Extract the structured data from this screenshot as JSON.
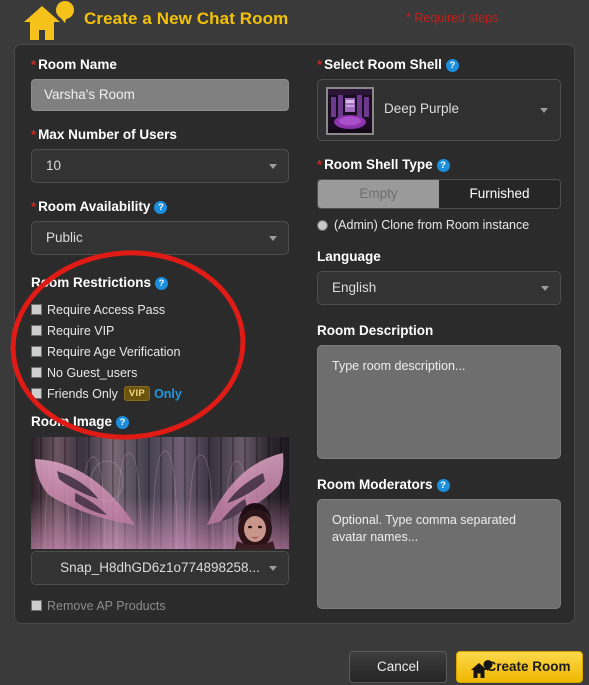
{
  "header": {
    "logo_icon": "house-chat-logo",
    "title": "Create a New Chat Room",
    "required_note": "* Required steps"
  },
  "left": {
    "room_name": {
      "label": "Room Name",
      "required": "*",
      "value": "Varsha's Room"
    },
    "max_users": {
      "label": "Max Number of Users",
      "required": "*",
      "value": "10"
    },
    "room_availability": {
      "label": "Room Availability",
      "required": "*",
      "help": "?",
      "value": "Public"
    },
    "room_restrictions": {
      "label": "Room Restrictions",
      "help": "?",
      "items": [
        {
          "label": "Require Access Pass",
          "checked": false
        },
        {
          "label": "Require VIP",
          "checked": false
        },
        {
          "label": "Require Age Verification",
          "checked": false
        },
        {
          "label": "No Guest_users",
          "checked": false
        },
        {
          "label": "Friends Only",
          "checked": false,
          "badge": "VIP",
          "suffix": "Only"
        }
      ]
    },
    "room_image": {
      "label": "Room Image",
      "help": "?",
      "filename": "Snap_H8dhGD6z1o774898258...",
      "remove_ap_label": "Remove AP Products"
    }
  },
  "right": {
    "room_shell": {
      "label": "Select Room Shell",
      "required": "*",
      "help": "?",
      "value": "Deep Purple",
      "thumb_icon": "purple-club-thumbnail"
    },
    "room_shell_type": {
      "label": "Room Shell Type",
      "required": "*",
      "help": "?",
      "options": [
        "Empty",
        "Furnished"
      ],
      "selected": "Empty",
      "clone_label": "(Admin) Clone from Room instance",
      "clone_selected": false
    },
    "language": {
      "label": "Language",
      "value": "English"
    },
    "room_description": {
      "label": "Room Description",
      "placeholder": "Type room description..."
    },
    "room_moderators": {
      "label": "Room Moderators",
      "help": "?",
      "placeholder": "Optional. Type comma separated avatar names..."
    }
  },
  "footer": {
    "cancel_label": "Cancel",
    "create_label": "Create Room"
  },
  "annotation": {
    "shape": "red-ellipse-highlight",
    "color": "#e01b15"
  },
  "colors": {
    "accent_yellow": "#f2c20a",
    "required_red": "#c2201c",
    "help_blue": "#1b8ede",
    "panel_bg": "#2b2b2b",
    "page_bg": "#3a3a3a",
    "annotation_red": "#e01b15"
  }
}
